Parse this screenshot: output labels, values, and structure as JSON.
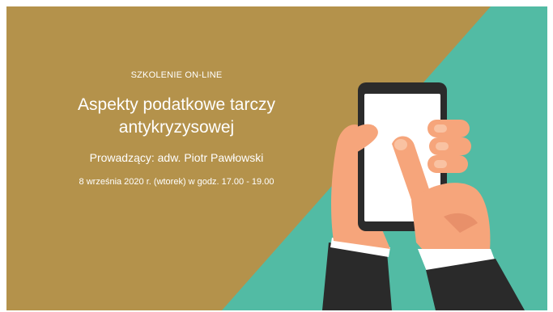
{
  "banner": {
    "eyebrow": "SZKOLENIE ON-LINE",
    "title_line1": "Aspekty podatkowe tarczy",
    "title_line2": "antykryzysowej",
    "host": "Prowadzący: adw. Piotr Pawłowski",
    "when": "8 września 2020 r. (wtorek) w godz. 17.00 - 19.00"
  },
  "colors": {
    "background_gold": "#b4924b",
    "background_teal": "#52bba4",
    "text": "#ffffff",
    "skin": "#f6a57b",
    "skin_shadow": "#e8906a",
    "phone_body": "#2b2b2b",
    "phone_screen": "#ffffff",
    "sleeve": "#2a2a2a",
    "cuff": "#ffffff"
  }
}
